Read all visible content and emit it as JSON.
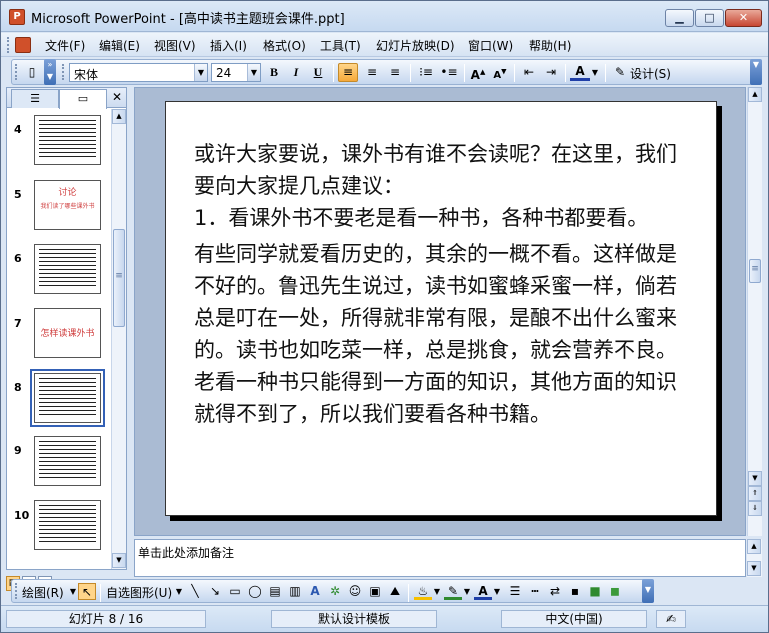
{
  "window": {
    "app_icon": "P",
    "title": "Microsoft PowerPoint - [高中读书主题班会课件.ppt]",
    "min_glyph": "▁",
    "max_glyph": "□",
    "close_glyph": "✕"
  },
  "menu": {
    "items": [
      "文件(F)",
      "编辑(E)",
      "视图(V)",
      "插入(I)",
      "格式(O)",
      "工具(T)",
      "幻灯片放映(D)",
      "窗口(W)",
      "帮助(H)"
    ]
  },
  "toolbar": {
    "font_name": "宋体",
    "font_size": "24",
    "bold": "B",
    "italic": "I",
    "underline": "U",
    "design_label": "设计(S)"
  },
  "left_pane": {
    "close_glyph": "✕",
    "thumbnails": [
      {
        "number": "4",
        "kind": "text"
      },
      {
        "number": "5",
        "kind": "title",
        "title": "讨论",
        "subtitle": "我们读了哪些课外书"
      },
      {
        "number": "6",
        "kind": "text"
      },
      {
        "number": "7",
        "kind": "title",
        "title": "怎样读课外书",
        "subtitle": ""
      },
      {
        "number": "8",
        "kind": "text",
        "selected": true
      },
      {
        "number": "9",
        "kind": "text"
      },
      {
        "number": "10",
        "kind": "text"
      }
    ]
  },
  "slide": {
    "paragraphs": [
      "或许大家要说，课外书有谁不会读呢？在这里，我们要向大家提几点建议：",
      "1．看课外书不要老是看一种书，各种书都要看。",
      "有些同学就爱看历史的，其余的一概不看。这样做是不好的。鲁迅先生说过，读书如蜜蜂采蜜一样，倘若总是叮在一处，所得就非常有限，是酿不出什么蜜来的。读书也如吃菜一样，总是挑食，就会营养不良。老看一种书只能得到一方面的知识，其他方面的知识就得不到了，所以我们要看各种书籍。"
    ]
  },
  "notes": {
    "placeholder": "单击此处添加备注"
  },
  "drawing_toolbar": {
    "draw_label": "绘图(R)",
    "autoshapes_label": "自选图形(U)"
  },
  "status": {
    "slide_position": "幻灯片 8 / 16",
    "design_template": "默认设计模板",
    "language": "中文(中国)"
  },
  "colors": {
    "accent_orange": "#f6a93a",
    "title_red": "#d04040",
    "selection_blue": "#3461b6"
  }
}
